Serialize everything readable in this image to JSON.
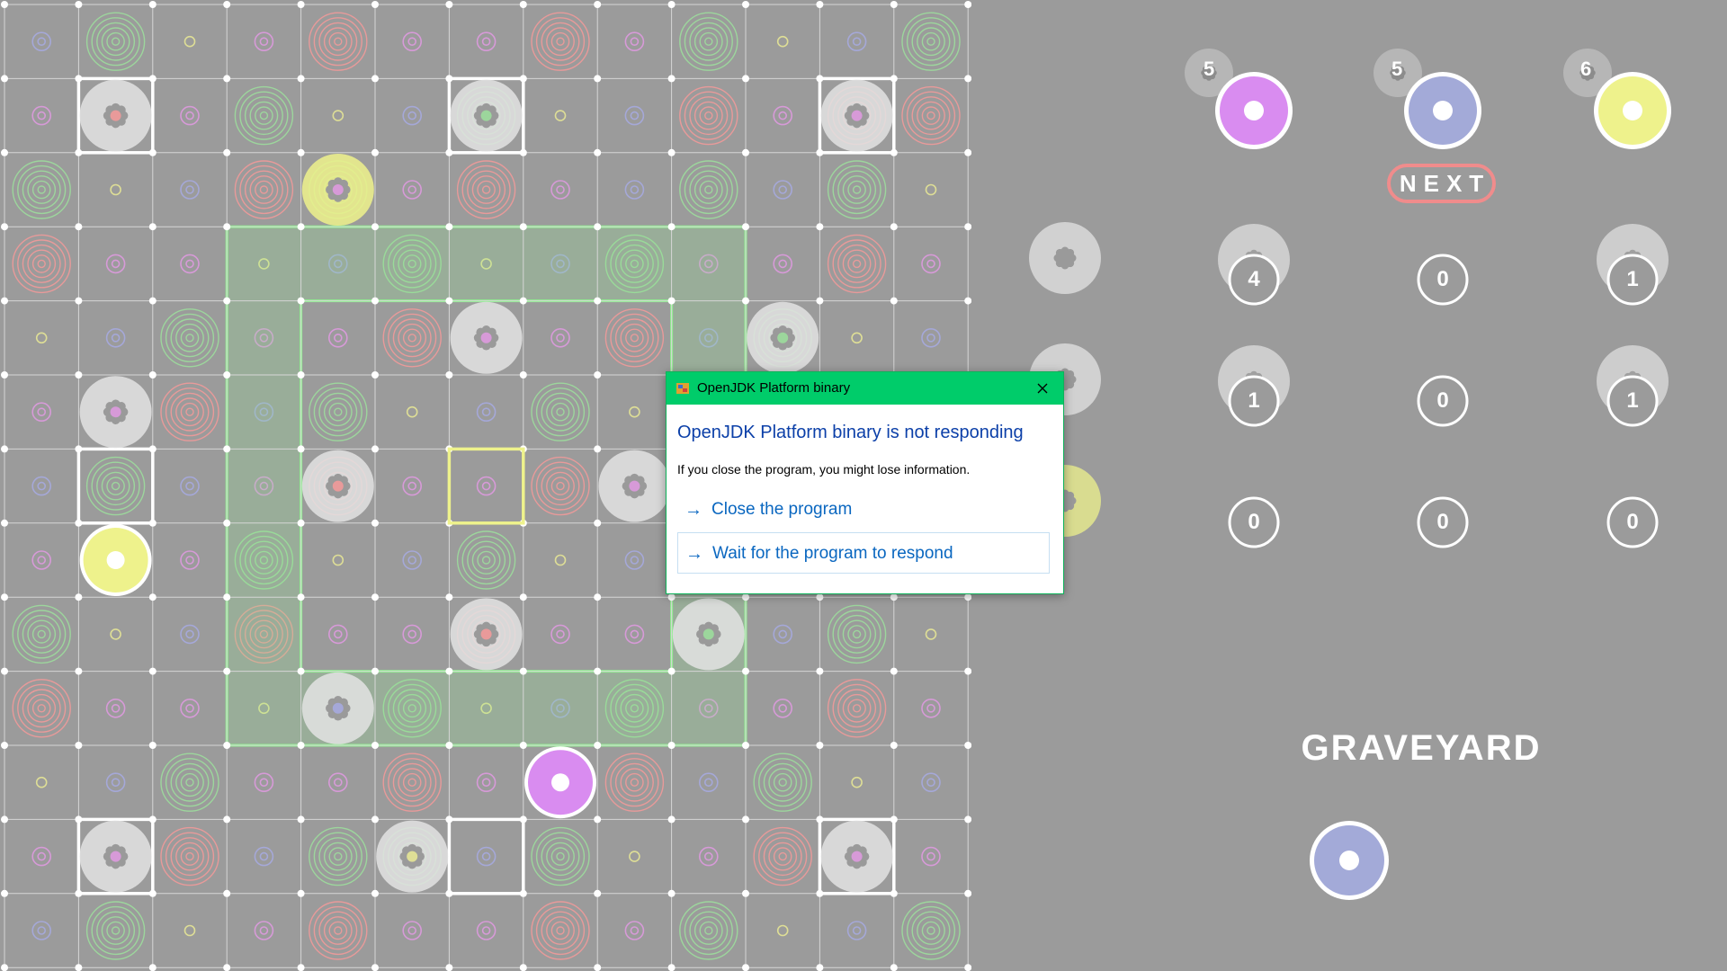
{
  "board": {
    "size": 13,
    "pattern": [
      [
        "b",
        "g",
        "y",
        "m",
        "r",
        "m",
        "m",
        "r",
        "m",
        "g",
        "y",
        "b",
        "g"
      ],
      [
        "m",
        "b",
        "m",
        "g",
        "y",
        "b",
        "g",
        "y",
        "b",
        "r",
        "m",
        "r",
        "r"
      ],
      [
        "g",
        "y",
        "b",
        "r",
        "g",
        "m",
        "r",
        "m",
        "b",
        "g",
        "b",
        "g",
        "y"
      ],
      [
        "r",
        "m",
        "m",
        "y",
        "b",
        "g",
        "y",
        "b",
        "g",
        "m",
        "m",
        "r",
        "m"
      ],
      [
        "y",
        "b",
        "g",
        "m",
        "m",
        "r",
        "b",
        "m",
        "r",
        "b",
        "g",
        "y",
        "b"
      ],
      [
        "m",
        "m",
        "r",
        "b",
        "g",
        "y",
        "b",
        "g",
        "y",
        "m",
        "m",
        "r",
        "m"
      ],
      [
        "b",
        "g",
        "b",
        "m",
        "r",
        "m",
        "m",
        "r",
        "b",
        "m",
        "b",
        "m",
        "y"
      ],
      [
        "m",
        "y",
        "m",
        "g",
        "y",
        "b",
        "g",
        "y",
        "b",
        "m",
        "g",
        "g",
        "m"
      ],
      [
        "g",
        "y",
        "b",
        "r",
        "m",
        "m",
        "r",
        "m",
        "m",
        "y",
        "b",
        "g",
        "y"
      ],
      [
        "r",
        "m",
        "m",
        "y",
        "b",
        "g",
        "y",
        "b",
        "g",
        "m",
        "m",
        "r",
        "m"
      ],
      [
        "y",
        "b",
        "g",
        "m",
        "m",
        "r",
        "m",
        "b",
        "r",
        "b",
        "g",
        "y",
        "b"
      ],
      [
        "m",
        "b",
        "r",
        "b",
        "g",
        "g",
        "b",
        "g",
        "y",
        "m",
        "r",
        "m",
        "m"
      ],
      [
        "b",
        "g",
        "y",
        "m",
        "r",
        "m",
        "m",
        "r",
        "m",
        "g",
        "y",
        "b",
        "g"
      ]
    ],
    "highlight_ring": {
      "outer": [
        3,
        3,
        9,
        9
      ],
      "inner": [
        4,
        4,
        8,
        8
      ]
    },
    "white_squares": [
      [
        1,
        1
      ],
      [
        1,
        6
      ],
      [
        1,
        11
      ],
      [
        6,
        1
      ],
      [
        11,
        1
      ],
      [
        11,
        6
      ],
      [
        11,
        11
      ]
    ],
    "yellow_square": [
      6,
      6
    ],
    "tokens": [
      {
        "row": 1,
        "col": 1,
        "type": "disc",
        "center": "r"
      },
      {
        "row": 1,
        "col": 6,
        "type": "disc",
        "center": "g"
      },
      {
        "row": 1,
        "col": 11,
        "type": "disc",
        "center": "m"
      },
      {
        "row": 2,
        "col": 4,
        "type": "yellow-disc",
        "center": "m"
      },
      {
        "row": 4,
        "col": 6,
        "type": "disc",
        "center": "m"
      },
      {
        "row": 4,
        "col": 10,
        "type": "disc",
        "center": "g"
      },
      {
        "row": 5,
        "col": 1,
        "type": "disc",
        "center": "m"
      },
      {
        "row": 6,
        "col": 4,
        "type": "disc",
        "center": "r"
      },
      {
        "row": 6,
        "col": 8,
        "type": "disc",
        "center": "m"
      },
      {
        "row": 7,
        "col": 1,
        "type": "piece",
        "color": "#eef28c"
      },
      {
        "row": 8,
        "col": 6,
        "type": "disc",
        "center": "r"
      },
      {
        "row": 8,
        "col": 9,
        "type": "disc",
        "center": "g"
      },
      {
        "row": 9,
        "col": 4,
        "type": "disc",
        "center": "b"
      },
      {
        "row": 10,
        "col": 7,
        "type": "piece",
        "color": "#d98cf0"
      },
      {
        "row": 11,
        "col": 1,
        "type": "disc",
        "center": "m"
      },
      {
        "row": 11,
        "col": 5,
        "type": "disc",
        "center": "y"
      },
      {
        "row": 11,
        "col": 11,
        "type": "disc",
        "center": "m"
      }
    ]
  },
  "colors": {
    "r": "#e89a9a",
    "g": "#9cd69c",
    "b": "#a5a8d8",
    "m": "#d79ad8",
    "y": "#dede96",
    "board_bg": "#9b9b9b",
    "grid_line": "#d6d6d6",
    "highlight": "#90ee90",
    "token": "#e3e3e3"
  },
  "players": [
    {
      "supply": "5",
      "color": "#d98cf0"
    },
    {
      "supply": "5",
      "color": "#a3aad8"
    },
    {
      "supply": "6",
      "color": "#eef28c"
    }
  ],
  "next_button": "NEXT",
  "counts": [
    [
      "4",
      "0",
      "1"
    ],
    [
      "1",
      "0",
      "1"
    ],
    [
      "0",
      "0",
      "0"
    ]
  ],
  "graveyard": {
    "title": "GRAVEYARD",
    "piece_color": "#a3aad8"
  },
  "dialog": {
    "title": "OpenJDK Platform binary",
    "heading": "OpenJDK Platform binary is not responding",
    "body": "If you close the program, you might lose information.",
    "options": [
      {
        "label": "Close the program",
        "arrow": "→"
      },
      {
        "label": "Wait for the program to respond",
        "arrow": "→"
      }
    ]
  },
  "icons": [
    "close-icon",
    "app-icon",
    "arrow-right-icon"
  ]
}
